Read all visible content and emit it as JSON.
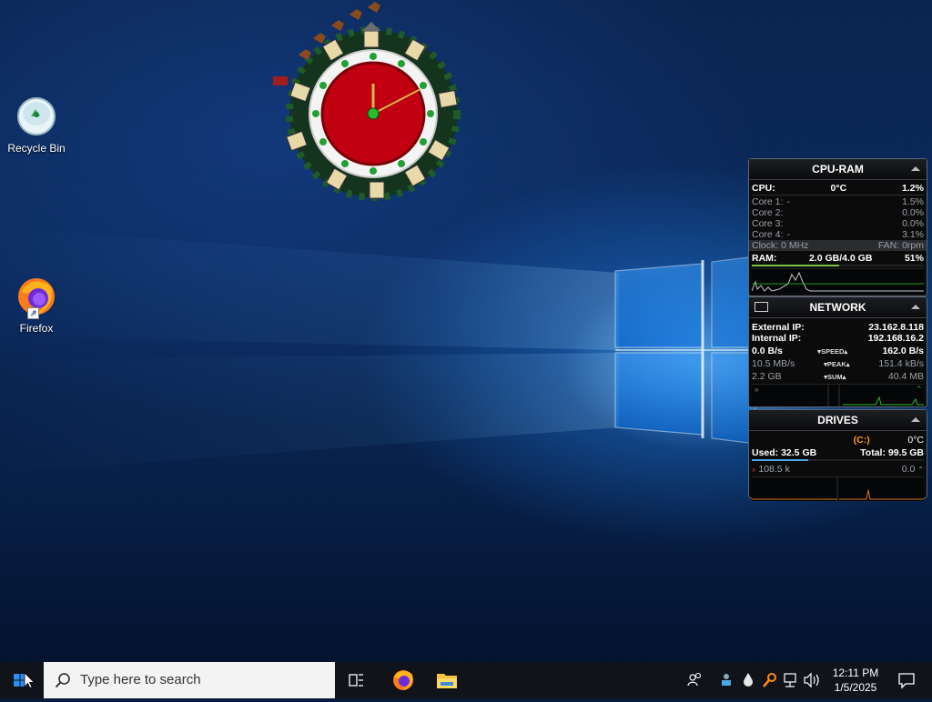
{
  "desktop": {
    "icons": [
      {
        "label": "Recycle Bin"
      },
      {
        "label": "Firefox"
      }
    ]
  },
  "cpu_ram": {
    "title": "CPU-RAM",
    "cpu_label": "CPU:",
    "cpu_temp": "0°C",
    "cpu_usage": "1.2%",
    "cores": [
      {
        "label": "Core 1:",
        "dash": "-",
        "value": "1.5%"
      },
      {
        "label": "Core 2:",
        "dash": "",
        "value": "0.0%"
      },
      {
        "label": "Core 3:",
        "dash": "",
        "value": "0.0%"
      },
      {
        "label": "Core 4:",
        "dash": "-",
        "value": "3.1%"
      }
    ],
    "clock": "Clock: 0 MHz",
    "fan": "FAN: 0rpm",
    "ram_label": "RAM:",
    "ram_value": "2.0 GB/4.0 GB",
    "ram_percent": "51%"
  },
  "network": {
    "title": "NETWORK",
    "external_ip_label": "External IP:",
    "external_ip": "23.162.8.118",
    "internal_ip_label": "Internal IP:",
    "internal_ip": "192.168.16.2",
    "speed_down": "0.0 B/s",
    "speed_label": "SPEED",
    "speed_up": "162.0 B/s",
    "peak_down": "10.5 MB/s",
    "peak_label": "PEAK",
    "peak_up": "151.4 kB/s",
    "sum_down": "2.2 GB",
    "sum_label": "SUM",
    "sum_up": "40.4 MB"
  },
  "drives": {
    "title": "DRIVES",
    "drive_letter": "(C:)",
    "temp": "0°C",
    "used": "Used: 32.5 GB",
    "total": "Total: 99.5 GB",
    "read": "108.5 k",
    "write": "0.0"
  },
  "taskbar": {
    "search_placeholder": "Type here to search",
    "time": "12:11 PM",
    "date": "1/5/2025"
  },
  "colors": {
    "accent": "#0078d7",
    "clock_face": "#c00010",
    "gadget_bg": "#0b0b0c",
    "graph_line": "#c8c8c8",
    "net_green": "#22c02a",
    "drive_orange": "#ff9a1f"
  }
}
